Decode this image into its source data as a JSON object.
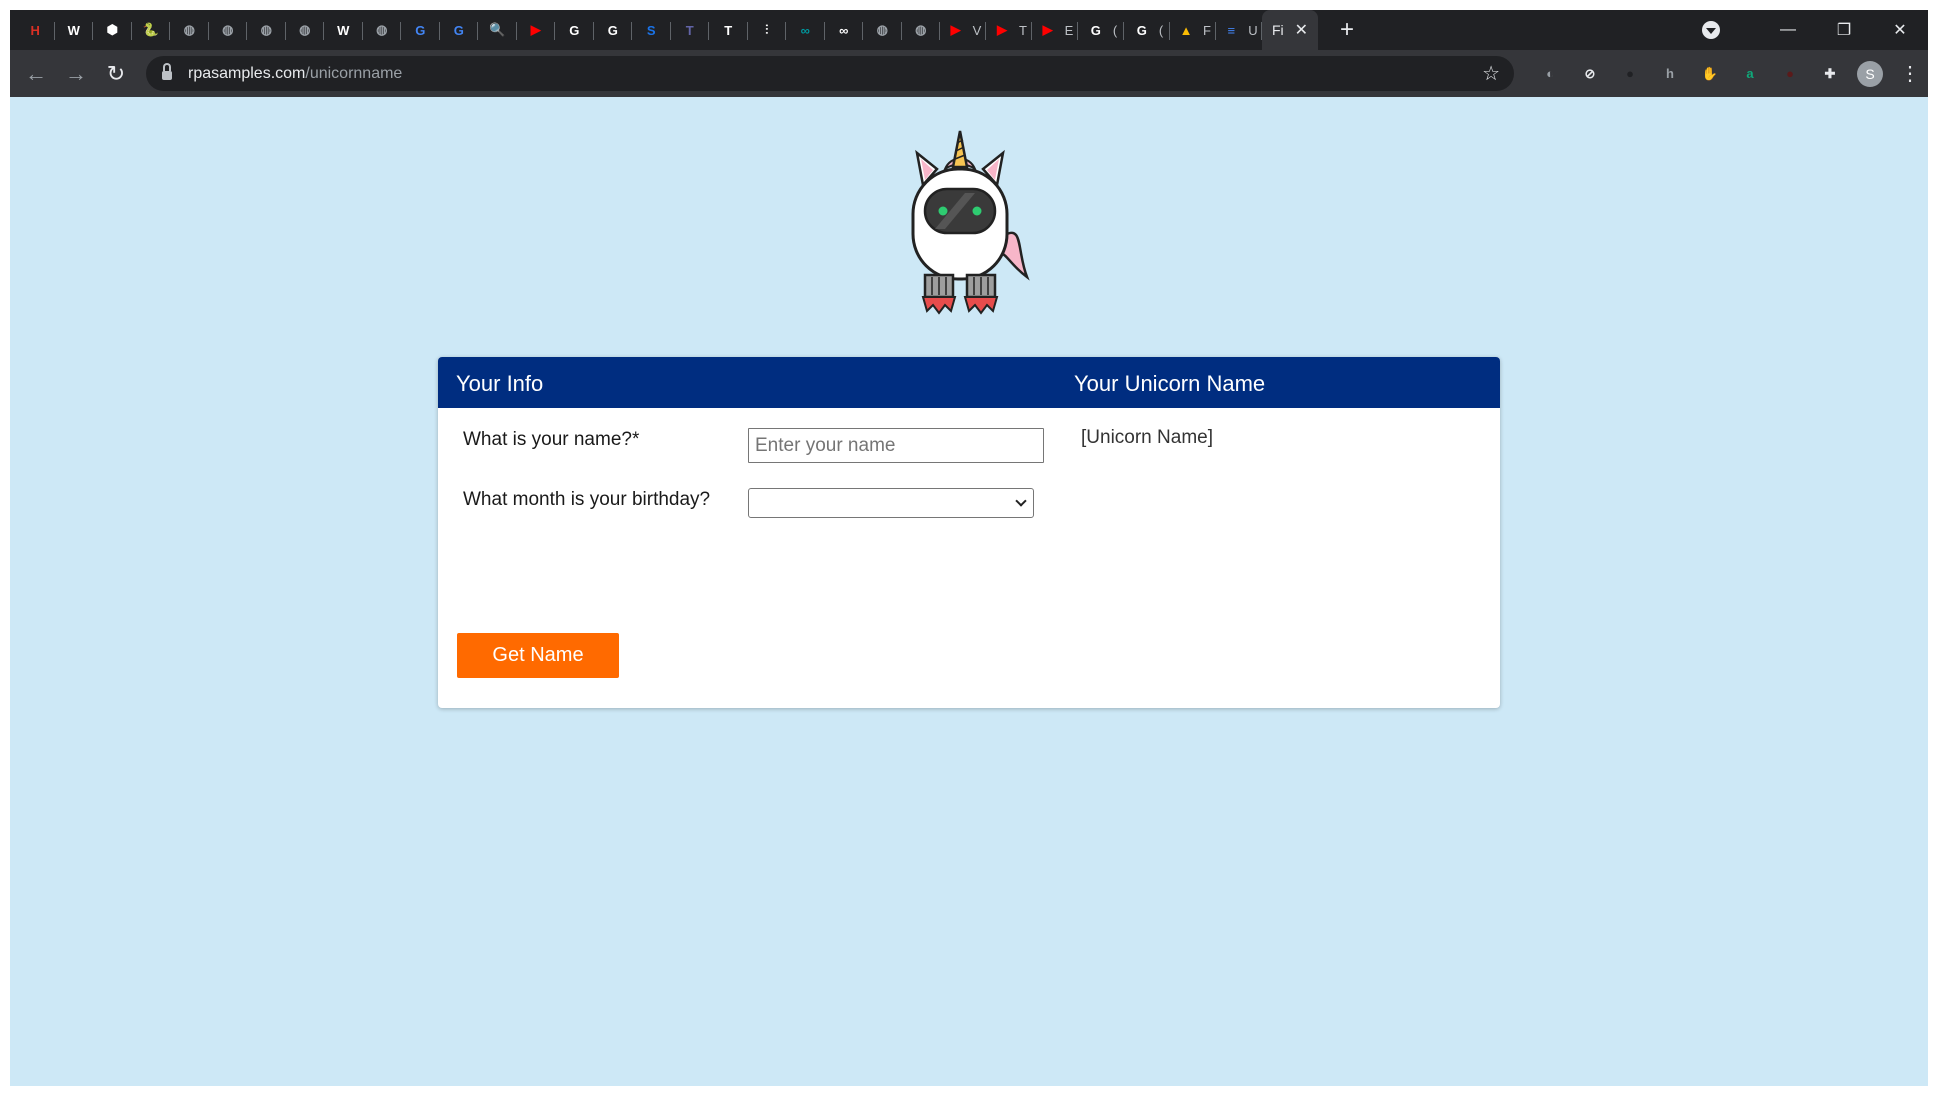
{
  "browser": {
    "tabs": [
      {
        "icon": "h-hexagon-icon",
        "color": "#d93025",
        "glyph": "H"
      },
      {
        "icon": "wordpress-icon",
        "color": "#ffffff",
        "glyph": "W"
      },
      {
        "icon": "white-hexagon-icon",
        "color": "#ffffff",
        "glyph": "⬢"
      },
      {
        "icon": "python-icon",
        "color": "#f4c430",
        "glyph": "🐍"
      },
      {
        "icon": "globe-icon",
        "color": "#9aa0a6",
        "glyph": "◍"
      },
      {
        "icon": "globe-icon",
        "color": "#9aa0a6",
        "glyph": "◍"
      },
      {
        "icon": "globe-icon",
        "color": "#9aa0a6",
        "glyph": "◍"
      },
      {
        "icon": "globe-icon",
        "color": "#9aa0a6",
        "glyph": "◍"
      },
      {
        "icon": "wordpress-icon",
        "color": "#ffffff",
        "glyph": "W"
      },
      {
        "icon": "globe-icon",
        "color": "#9aa0a6",
        "glyph": "◍"
      },
      {
        "icon": "translate-icon",
        "color": "#4285f4",
        "glyph": "G"
      },
      {
        "icon": "translate-icon",
        "color": "#4285f4",
        "glyph": "G"
      },
      {
        "icon": "magnifier-icon",
        "color": "#ffffff",
        "glyph": "🔍"
      },
      {
        "icon": "youtube-icon",
        "color": "#ff0000",
        "glyph": "▶"
      },
      {
        "icon": "google-icon",
        "color": "#ffffff",
        "glyph": "G"
      },
      {
        "icon": "google-icon",
        "color": "#ffffff",
        "glyph": "G"
      },
      {
        "icon": "s-icon",
        "color": "#1a73e8",
        "glyph": "S"
      },
      {
        "icon": "teams-icon",
        "color": "#6264a7",
        "glyph": "T"
      },
      {
        "icon": "t-icon",
        "color": "#ffffff",
        "glyph": "T"
      },
      {
        "icon": "fork-icon",
        "color": "#ffffff",
        "glyph": "⫶"
      },
      {
        "icon": "infinity-teal-icon",
        "color": "#00979d",
        "glyph": "∞"
      },
      {
        "icon": "infinity-icon",
        "color": "#ffffff",
        "glyph": "∞"
      },
      {
        "icon": "globe-icon",
        "color": "#9aa0a6",
        "glyph": "◍"
      },
      {
        "icon": "globe-icon",
        "color": "#9aa0a6",
        "glyph": "◍"
      },
      {
        "icon": "youtube-icon",
        "color": "#ff0000",
        "glyph": "▶",
        "title": "V"
      },
      {
        "icon": "youtube-icon",
        "color": "#ff0000",
        "glyph": "▶",
        "title": "T"
      },
      {
        "icon": "youtube-icon",
        "color": "#ff0000",
        "glyph": "▶",
        "title": "E"
      },
      {
        "icon": "google-icon",
        "color": "#ffffff",
        "glyph": "G",
        "title": "("
      },
      {
        "icon": "google-icon",
        "color": "#ffffff",
        "glyph": "G",
        "title": "("
      },
      {
        "icon": "google-drive-icon",
        "color": "#fbbc04",
        "glyph": "▲",
        "title": "F"
      },
      {
        "icon": "google-docs-icon",
        "color": "#4285f4",
        "glyph": "≡",
        "title": "U"
      }
    ],
    "active_tab": {
      "title": "Fi",
      "close": "✕"
    },
    "new_tab": "+",
    "window_controls": {
      "minimize": "—",
      "restore": "❐",
      "close": "✕"
    },
    "url_domain": "rpasamples.com",
    "url_path": "/unicornname",
    "extensions": [
      {
        "icon": "chrome-ext-icon",
        "color": "#9aa0a6",
        "glyph": "◐"
      },
      {
        "icon": "block-icon",
        "color": "#e8eaed",
        "glyph": "⊘"
      },
      {
        "icon": "drop-icon",
        "color": "#202124",
        "glyph": "●"
      },
      {
        "icon": "h-ext-icon",
        "color": "#9aa0a6",
        "glyph": "h"
      },
      {
        "icon": "hand-icon",
        "color": "#d93025",
        "glyph": "✋"
      },
      {
        "icon": "a-ext-icon",
        "color": "#0fa97a",
        "glyph": "a"
      },
      {
        "icon": "dark-circle-icon",
        "color": "#5a1a1a",
        "glyph": "●"
      },
      {
        "icon": "puzzle-icon",
        "color": "#e8eaed",
        "glyph": "✚"
      }
    ],
    "profile_initial": "S"
  },
  "page": {
    "background": "#cde8f6",
    "header_left": "Your Info",
    "header_right": "Your Unicorn Name",
    "name_question": "What is your name?*",
    "name_placeholder": "Enter your name",
    "name_value": "",
    "month_question": "What month is your birthday?",
    "month_selected": "",
    "unicorn_name": "[Unicorn Name]",
    "button_label": "Get Name",
    "accent_color": "#ff6a00",
    "header_color": "#002d80"
  }
}
